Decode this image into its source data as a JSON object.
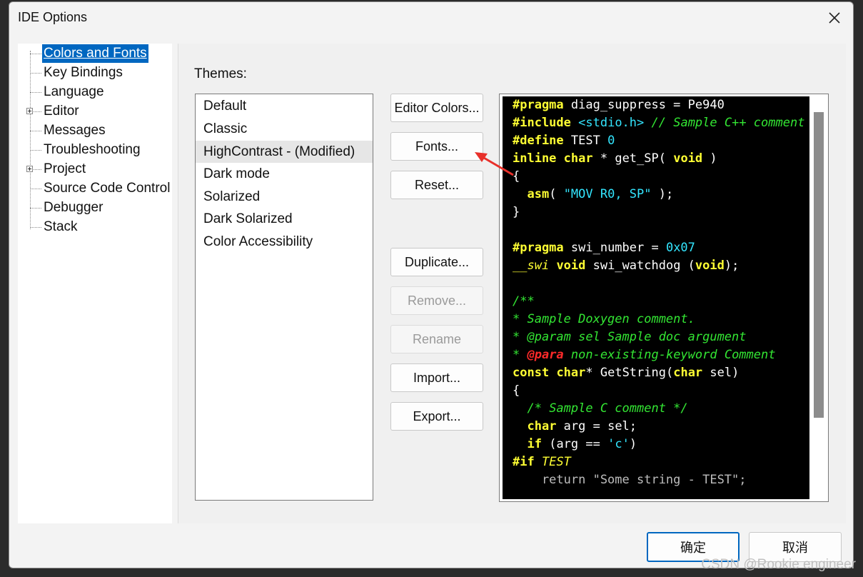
{
  "window": {
    "title": "IDE Options"
  },
  "tree": {
    "items": [
      {
        "label": "Colors and Fonts",
        "selected": true,
        "expandable": false
      },
      {
        "label": "Key Bindings",
        "selected": false,
        "expandable": false
      },
      {
        "label": "Language",
        "selected": false,
        "expandable": false
      },
      {
        "label": "Editor",
        "selected": false,
        "expandable": true
      },
      {
        "label": "Messages",
        "selected": false,
        "expandable": false
      },
      {
        "label": "Troubleshooting",
        "selected": false,
        "expandable": false
      },
      {
        "label": "Project",
        "selected": false,
        "expandable": true
      },
      {
        "label": "Source Code Control",
        "selected": false,
        "expandable": false
      },
      {
        "label": "Debugger",
        "selected": false,
        "expandable": false
      },
      {
        "label": "Stack",
        "selected": false,
        "expandable": false
      }
    ]
  },
  "themes": {
    "label": "Themes:",
    "items": [
      "Default",
      "Classic",
      "HighContrast - (Modified)",
      "Dark mode",
      "Solarized",
      "Dark Solarized",
      "Color Accessibility"
    ],
    "active_index": 2
  },
  "buttons": {
    "editor_colors": "Editor Colors...",
    "fonts": "Fonts...",
    "reset": "Reset...",
    "duplicate": "Duplicate...",
    "remove": "Remove...",
    "rename": "Rename",
    "import": "Import...",
    "export": "Export..."
  },
  "preview": {
    "lines": [
      "#pragma diag_suppress = Pe940",
      "#include <stdio.h> // Sample C++ comment",
      "#define TEST 0",
      "inline char * get_SP( void )",
      "{",
      "  asm( \"MOV R0, SP\" );",
      "}",
      "",
      "#pragma swi_number = 0x07",
      "__swi void swi_watchdog (void);",
      "",
      "/**",
      "* Sample Doxygen comment.",
      "* @param sel Sample doc argument",
      "* @para non-existing-keyword Comment",
      "const char* GetString(char sel)",
      "{",
      "  /* Sample C comment */",
      "  char arg = sel;",
      "  if (arg == 'c')",
      "#if TEST",
      "    return \"Some string - TEST\";"
    ]
  },
  "footer": {
    "ok": "确定",
    "cancel": "取消"
  },
  "watermark": "CSDN @Rookie engineer",
  "colors": {
    "keyword": "#ffff33",
    "string": "#33e6ff",
    "comment": "#33e633",
    "doc_invalid": "#ff2a2a",
    "selection": "#0067c0",
    "arrow": "#e8302a"
  }
}
